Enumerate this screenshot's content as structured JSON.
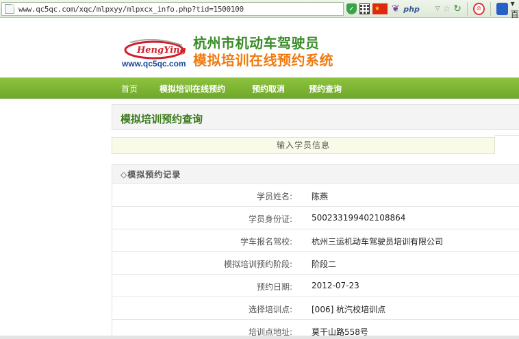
{
  "browser": {
    "url": "www.qc5qc.com/xqc/mlpxyy/mlpxcx_info.php?tid=1500100",
    "icons": [
      "page-icon",
      "shield-icon",
      "qr-code-icon",
      "china-flag-icon",
      "feather-icon",
      "php-icon",
      "windows-icon",
      "dropdown-icon",
      "star-icon",
      "reload-icon",
      "adblock-icon",
      "baidu-paw-icon"
    ],
    "php_label": "php",
    "tail_text": "▾ 百"
  },
  "header": {
    "logo_text": "HengYing",
    "logo_url": "www.qc5qc.com",
    "title_line1": "杭州市机动车驾驶员",
    "title_line2": "模拟培训在线预约系统"
  },
  "nav": {
    "items": [
      "首页",
      "模拟培训在线预约",
      "预约取消",
      "预约查询"
    ]
  },
  "page": {
    "section_title": "模拟培训预约查询",
    "info_text": "输入学员信息",
    "records_title": "◇模拟预约记录"
  },
  "records": [
    {
      "label": "学员姓名:",
      "value": "陈燕"
    },
    {
      "label": "学员身份证:",
      "value": "500233199402108864"
    },
    {
      "label": "学车报名驾校:",
      "value": "杭州三运机动车驾驶员培训有限公司"
    },
    {
      "label": "模拟培训预约阶段:",
      "value": "阶段二"
    },
    {
      "label": "预约日期:",
      "value": "2012-07-23"
    },
    {
      "label": "选择培训点:",
      "value": "[006] 杭汽校培训点"
    },
    {
      "label": "培训点地址:",
      "value": "莫干山路558号"
    }
  ],
  "colors": {
    "nav_green": "#7bb332",
    "title_green": "#3a8a28",
    "title_orange": "#f07a10",
    "logo_red": "#d0202a"
  }
}
